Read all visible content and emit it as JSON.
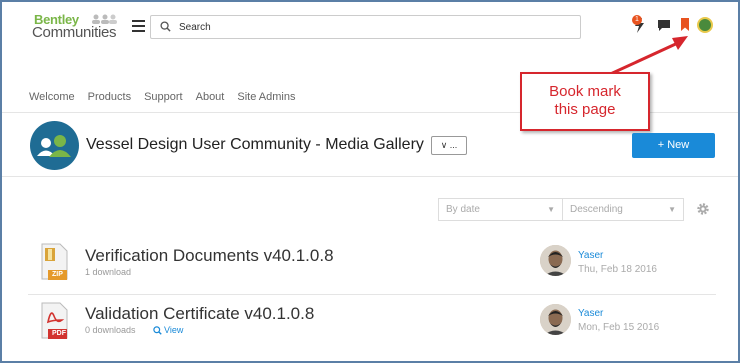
{
  "header": {
    "logo_top": "Bentley",
    "logo_bottom": "Communities",
    "search_placeholder": "Search",
    "notification_count": "1"
  },
  "nav": [
    "Welcome",
    "Products",
    "Support",
    "About",
    "Site Admins"
  ],
  "annotation": {
    "line1": "Book mark",
    "line2": "this page",
    "color": "#d6262d"
  },
  "group": {
    "title": "Vessel Design User Community - Media Gallery",
    "more_label": "∨ ...",
    "new_label": "+ New"
  },
  "sort": {
    "by": "By date",
    "direction": "Descending"
  },
  "items": [
    {
      "title": "Verification Documents v40.1.0.8",
      "meta": "1 download",
      "view": "",
      "file_type": "ZIP",
      "author": "Yaser",
      "date": "Thu, Feb 18 2016"
    },
    {
      "title": "Validation Certificate v40.1.0.8",
      "meta": "0 downloads",
      "view": "View",
      "file_type": "PDF",
      "author": "Yaser",
      "date": "Mon, Feb 15 2016"
    }
  ],
  "colors": {
    "accent": "#1a8ad8",
    "brand_green": "#7ab648",
    "bookmark": "#e8531f"
  }
}
